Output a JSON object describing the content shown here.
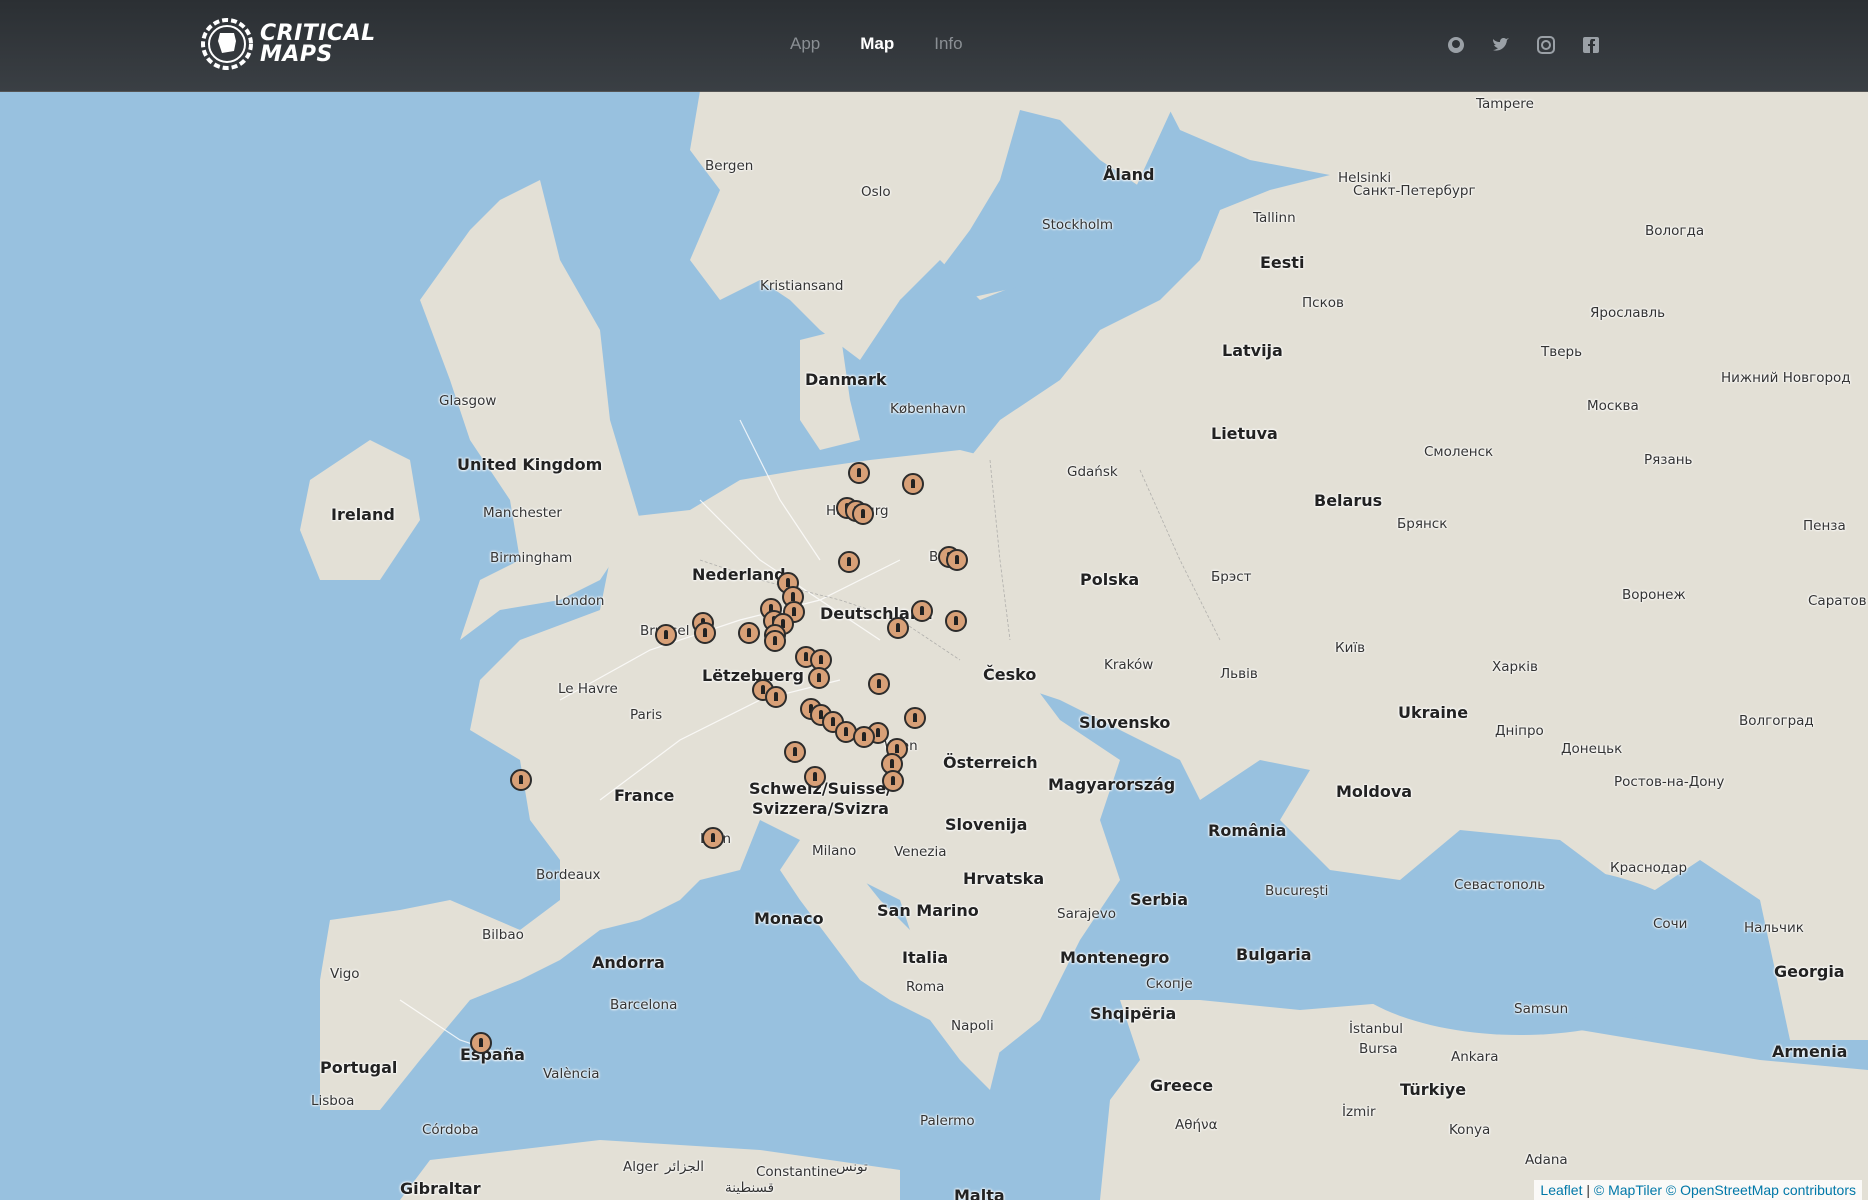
{
  "header": {
    "logo_line1": "CRITICAL",
    "logo_line2": "MAPS",
    "nav": [
      {
        "label": "App",
        "active": false
      },
      {
        "label": "Map",
        "active": true
      },
      {
        "label": "Info",
        "active": false
      }
    ],
    "social_icons": [
      "github-icon",
      "twitter-icon",
      "instagram-icon",
      "facebook-icon"
    ]
  },
  "map": {
    "countries": [
      "Åland",
      "Eesti",
      "Latvija",
      "Lietuva",
      "Danmark",
      "United Kingdom",
      "Ireland",
      "Nederland",
      "Deutschland",
      "Lëtzebuerg",
      "Polska",
      "Belarus",
      "Česko",
      "Slovensko",
      "Ukraine",
      "Österreich",
      "Magyarország",
      "Moldova",
      "France",
      "Schweiz/Suisse/",
      "Svizzera/Svizra",
      "Slovenija",
      "România",
      "Hrvatska",
      "Serbia",
      "Monaco",
      "San Marino",
      "Andorra",
      "Italia",
      "Montenegro",
      "Bulgaria",
      "Shqipëria",
      "Portugal",
      "España",
      "Greece",
      "Türkiye",
      "Georgia",
      "Armenia",
      "Gibraltar",
      "Malta"
    ],
    "cities": [
      "Tampere",
      "Bergen",
      "Helsinki",
      "Санкт-Петербург",
      "Oslo",
      "Stockholm",
      "Tallinn",
      "Вологда",
      "Kristiansand",
      "Псков",
      "Ярославль",
      "Тверь",
      "Нижний Новгород",
      "Glasgow",
      "København",
      "Москва",
      "Manchester",
      "Gdańsk",
      "Смоленск",
      "Рязань",
      "Birmingham",
      "Брянск",
      "Пенза",
      "London",
      "Брэст",
      "Воронеж",
      "Саратов",
      "Le Havre",
      "Kraków",
      "Київ",
      "Paris",
      "Львів",
      "Харків",
      "Дніпро",
      "Волгоград",
      "Донецьк",
      "Ростов-на-Дону",
      "Milano",
      "Venezia",
      "Bordeaux",
      "Bucureşti",
      "Севастополь",
      "Краснодар",
      "Bilbao",
      "Sarajevo",
      "Сочи",
      "Нальчик",
      "Vigo",
      "Barcelona",
      "Roma",
      "Скопје",
      "Napoli",
      "İstanbul",
      "Samsun",
      "Bursa",
      "Ankara",
      "València",
      "Lisboa",
      "Córdoba",
      "Palermo",
      "Αθήνα",
      "İzmir",
      "Konya",
      "Adana",
      "Alger",
      "الجزائر",
      "Constantine",
      "قسنطينة",
      "تونس",
      "Hamburg",
      "Berlin",
      "Brussel",
      "Wien",
      "Lyon"
    ]
  },
  "attribution": {
    "leaflet": "Leaflet",
    "sep": "|",
    "maptiler": "© MapTiler",
    "osm": "© OpenStreetMap contributors"
  },
  "colors": {
    "water": "#98c1df",
    "land": "#e3e0d6",
    "header": "#2e3236",
    "marker": "#d8a077"
  }
}
